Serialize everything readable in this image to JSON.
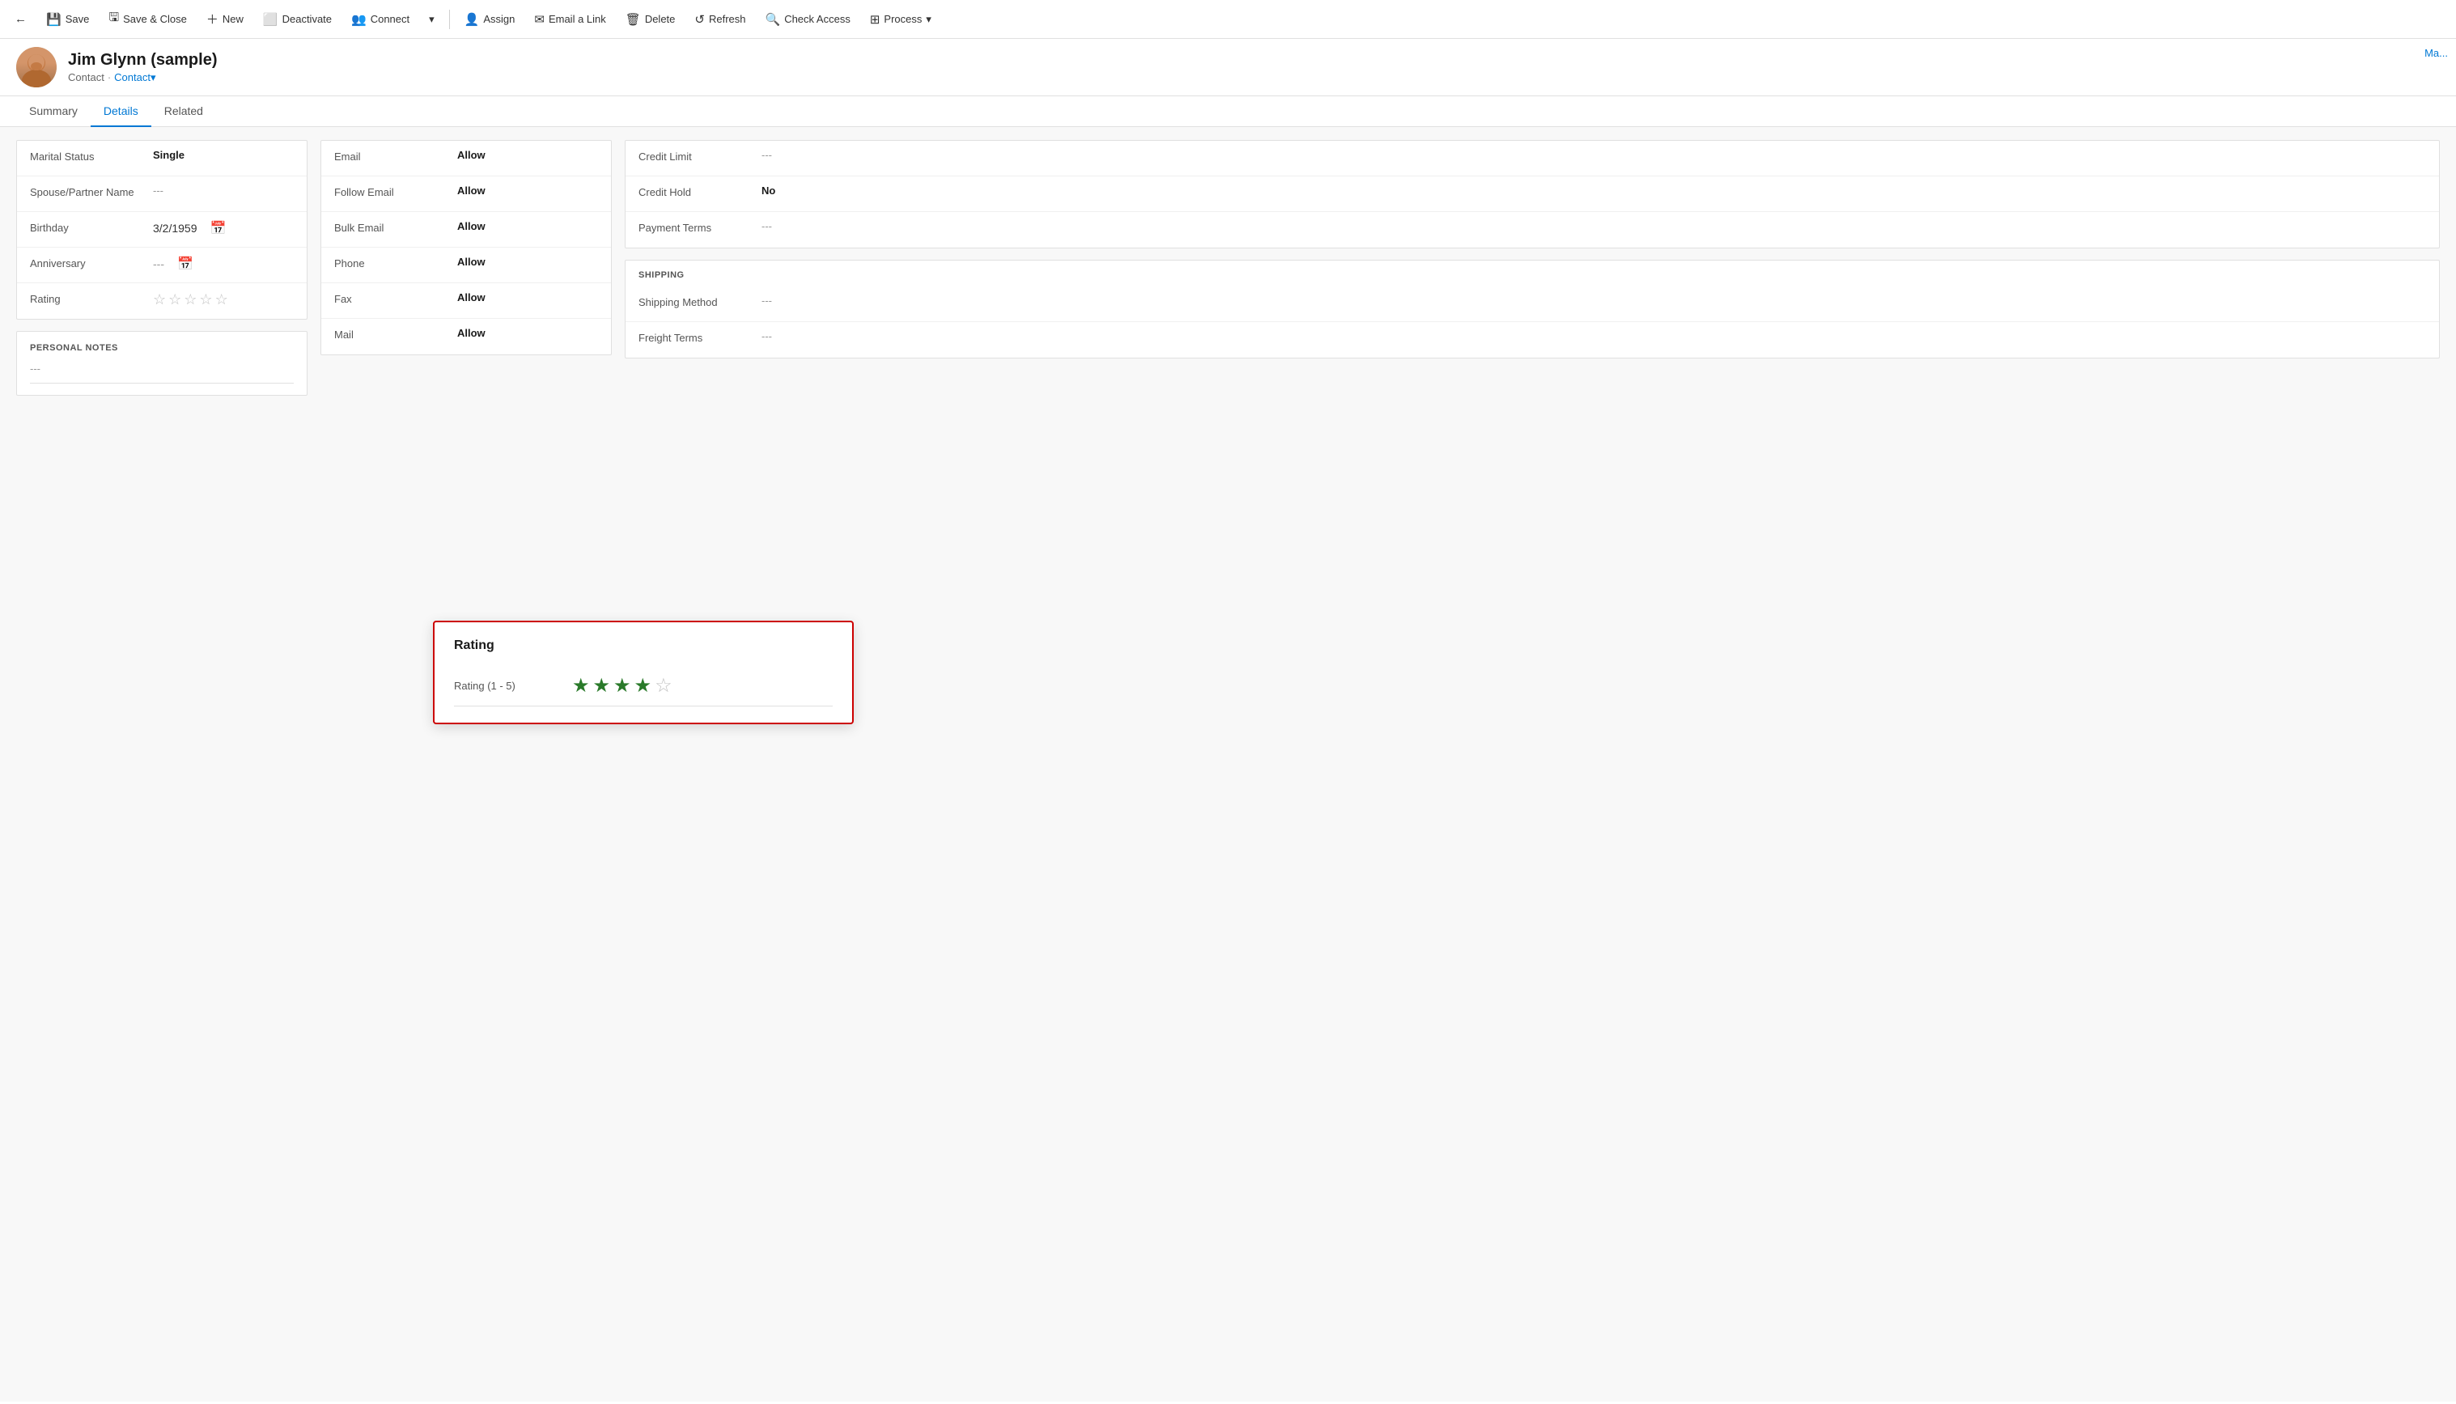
{
  "toolbar": {
    "back_icon": "←",
    "save_label": "Save",
    "save_close_label": "Save & Close",
    "new_label": "New",
    "deactivate_label": "Deactivate",
    "connect_label": "Connect",
    "dropdown_icon": "▾",
    "assign_label": "Assign",
    "email_link_label": "Email a Link",
    "delete_label": "Delete",
    "refresh_label": "Refresh",
    "check_access_label": "Check Access",
    "process_label": "Process",
    "process_dropdown": "▾"
  },
  "header": {
    "avatar_icon": "👤",
    "name": "Jim Glynn (sample)",
    "breadcrumb1": "Contact",
    "separator": "·",
    "breadcrumb2": "Contact",
    "dropdown_icon": "▾"
  },
  "tabs": {
    "items": [
      {
        "label": "Summary",
        "active": false
      },
      {
        "label": "Details",
        "active": true
      },
      {
        "label": "Related",
        "active": false
      }
    ]
  },
  "personal_info": {
    "fields": [
      {
        "label": "Marital Status",
        "value": "Single",
        "bold": true,
        "empty": false
      },
      {
        "label": "Spouse/Partner Name",
        "value": "---",
        "bold": false,
        "empty": true
      },
      {
        "label": "Birthday",
        "value": "3/2/1959",
        "bold": false,
        "empty": false,
        "has_calendar": true
      },
      {
        "label": "Anniversary",
        "value": "---",
        "bold": false,
        "empty": true,
        "has_calendar": true
      },
      {
        "label": "Rating",
        "value": "",
        "is_stars": true
      }
    ]
  },
  "personal_notes": {
    "title": "PERSONAL NOTES",
    "content": "---"
  },
  "contact_preferences": {
    "fields": [
      {
        "label": "Email",
        "value": "Allow",
        "bold": true
      },
      {
        "label": "Follow Email",
        "value": "Allow",
        "bold": true
      },
      {
        "label": "Bulk Email",
        "value": "Allow",
        "bold": true
      },
      {
        "label": "Phone",
        "value": "Allow",
        "bold": true
      },
      {
        "label": "Fax",
        "value": "Allow",
        "bold": true
      },
      {
        "label": "Mail",
        "value": "Allow",
        "bold": true
      }
    ]
  },
  "billing": {
    "fields": [
      {
        "label": "Credit Limit",
        "value": "---",
        "bold": false,
        "empty": true
      },
      {
        "label": "Credit Hold",
        "value": "No",
        "bold": true,
        "empty": false
      },
      {
        "label": "Payment Terms",
        "value": "---",
        "bold": false,
        "empty": true
      }
    ]
  },
  "shipping": {
    "title": "SHIPPING",
    "fields": [
      {
        "label": "Shipping Method",
        "value": "---",
        "bold": false,
        "empty": true
      },
      {
        "label": "Freight Terms",
        "value": "---",
        "bold": false,
        "empty": true
      }
    ]
  },
  "rating_popup": {
    "title": "Rating",
    "label": "Rating (1 - 5)",
    "filled_stars": 4,
    "total_stars": 5
  },
  "top_right": {
    "text": "Ma..."
  }
}
